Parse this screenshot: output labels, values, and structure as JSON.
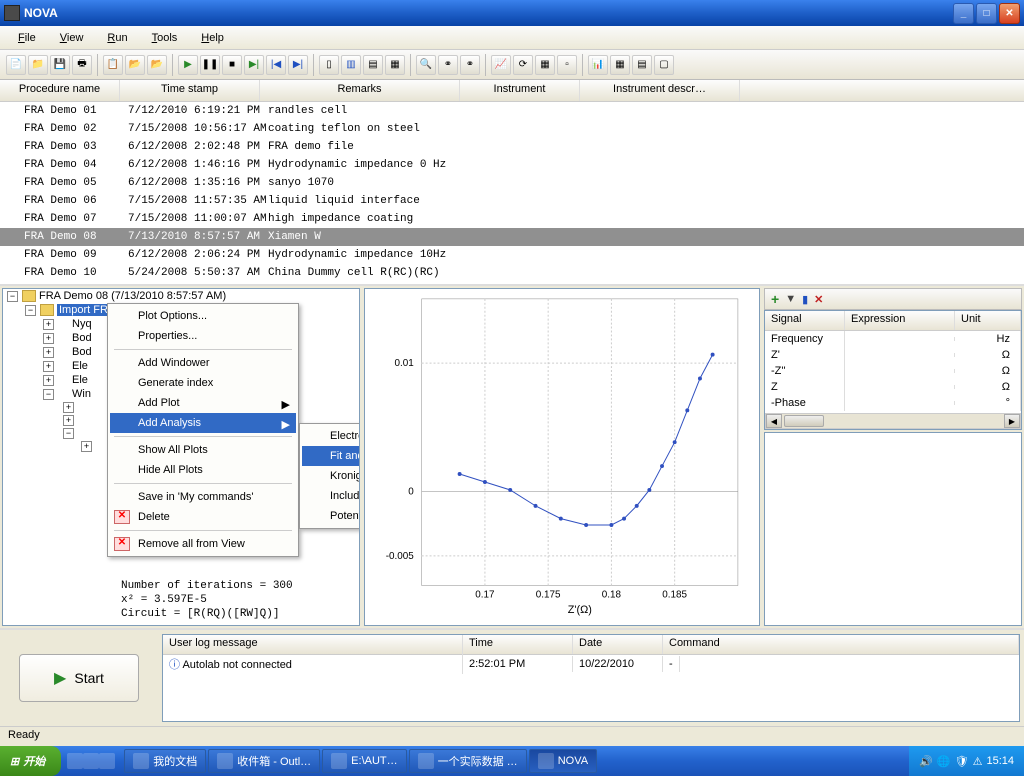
{
  "titlebar": {
    "title": "NOVA"
  },
  "menubar": [
    "File",
    "View",
    "Run",
    "Tools",
    "Help"
  ],
  "table": {
    "headers": [
      "Procedure name",
      "Time stamp",
      "Remarks",
      "Instrument",
      "Instrument descr…"
    ],
    "rows": [
      {
        "name": "FRA Demo 01",
        "ts": "7/12/2010 6:19:21 PM",
        "rem": "randles cell"
      },
      {
        "name": "FRA Demo 02",
        "ts": "7/15/2008 10:56:17 AM",
        "rem": "coating teflon on steel"
      },
      {
        "name": "FRA Demo 03",
        "ts": "6/12/2008 2:02:48 PM",
        "rem": "FRA demo file"
      },
      {
        "name": "FRA Demo 04",
        "ts": "6/12/2008 1:46:16 PM",
        "rem": "Hydrodynamic impedance 0 Hz"
      },
      {
        "name": "FRA Demo 05",
        "ts": "6/12/2008 1:35:16 PM",
        "rem": "sanyo 1070"
      },
      {
        "name": "FRA Demo 06",
        "ts": "7/15/2008 11:57:35 AM",
        "rem": "liquid liquid interface"
      },
      {
        "name": "FRA Demo 07",
        "ts": "7/15/2008 11:00:07 AM",
        "rem": "high impedance coating"
      },
      {
        "name": "FRA Demo 08",
        "ts": "7/13/2010 8:57:57 AM",
        "rem": "Xiamen W"
      },
      {
        "name": "FRA Demo 09",
        "ts": "6/12/2008 2:06:24 PM",
        "rem": "Hydrodynamic impedance 10Hz"
      },
      {
        "name": "FRA Demo 10",
        "ts": "5/24/2008 5:50:37 AM",
        "rem": "China Dummy cell R(RC)(RC)"
      }
    ]
  },
  "tree": {
    "root": "FRA Demo 08 (7/13/2010 8:57:57 AM)",
    "selected": "Import FRA data",
    "children": [
      "Nyq",
      "Bod",
      "Bod",
      "Ele",
      "Ele",
      "Win"
    ],
    "bottom_lines": [
      "Number of iterations = 300",
      "x² = 3.597E-5",
      "Circuit = [R(RQ)([RW]Q)]"
    ]
  },
  "context_menu": {
    "items": [
      "Plot Options...",
      "Properties...",
      "",
      "Add Windower",
      "Generate index",
      "Add Plot",
      "Add Analysis",
      "",
      "Show All Plots",
      "Hide All Plots",
      "",
      "Save in 'My commands'",
      "Delete",
      "",
      "Remove all from View"
    ],
    "highlighted": "Add Analysis"
  },
  "submenu": {
    "items": [
      "Electrochemical circle fit",
      "Fit and Simulation",
      "Kronig-Kramers",
      "Include all FRA data",
      "Potential scan FRA data"
    ],
    "highlighted": "Fit and Simulation"
  },
  "plot": {
    "xlabel": "Z'(Ω)",
    "yticks": [
      "0.01",
      "0",
      "-0.005"
    ],
    "xticks": [
      "0.17",
      "0.175",
      "0.18",
      "0.185"
    ]
  },
  "signals": {
    "headers": [
      "Signal",
      "Expression",
      "Unit"
    ],
    "rows": [
      {
        "s": "Frequency",
        "u": "Hz"
      },
      {
        "s": "Z'",
        "u": "Ω"
      },
      {
        "s": "-Z''",
        "u": "Ω"
      },
      {
        "s": "Z",
        "u": "Ω"
      },
      {
        "s": "-Phase",
        "u": "°"
      }
    ]
  },
  "right_icons": {
    "add": "+",
    "filter": "▼",
    "cols": "▮",
    "del": "✕"
  },
  "start_label": "Start",
  "log": {
    "headers": [
      "User log message",
      "Time",
      "Date",
      "Command"
    ],
    "row": {
      "msg": "Autolab not connected",
      "time": "2:52:01 PM",
      "date": "10/22/2010",
      "cmd": "-"
    }
  },
  "status": "Ready",
  "taskbar": {
    "start": "开始",
    "items": [
      "我的文档",
      "收件箱 - Outl…",
      "E:\\AUT…",
      "一个实际数据 …",
      "NOVA"
    ],
    "clock": "15:14"
  },
  "chart_data": {
    "type": "scatter",
    "title": "",
    "xlabel": "Z'(Ω)",
    "ylabel": "",
    "xlim": [
      0.165,
      0.19
    ],
    "ylim": [
      -0.006,
      0.012
    ],
    "x": [
      0.168,
      0.17,
      0.172,
      0.174,
      0.176,
      0.178,
      0.18,
      0.181,
      0.182,
      0.183,
      0.184,
      0.185,
      0.186,
      0.187,
      0.188
    ],
    "y": [
      0.001,
      0.0005,
      0.0,
      -0.001,
      -0.0018,
      -0.0022,
      -0.0022,
      -0.0018,
      -0.001,
      0.0,
      0.0015,
      0.003,
      0.005,
      0.007,
      0.0085
    ]
  }
}
